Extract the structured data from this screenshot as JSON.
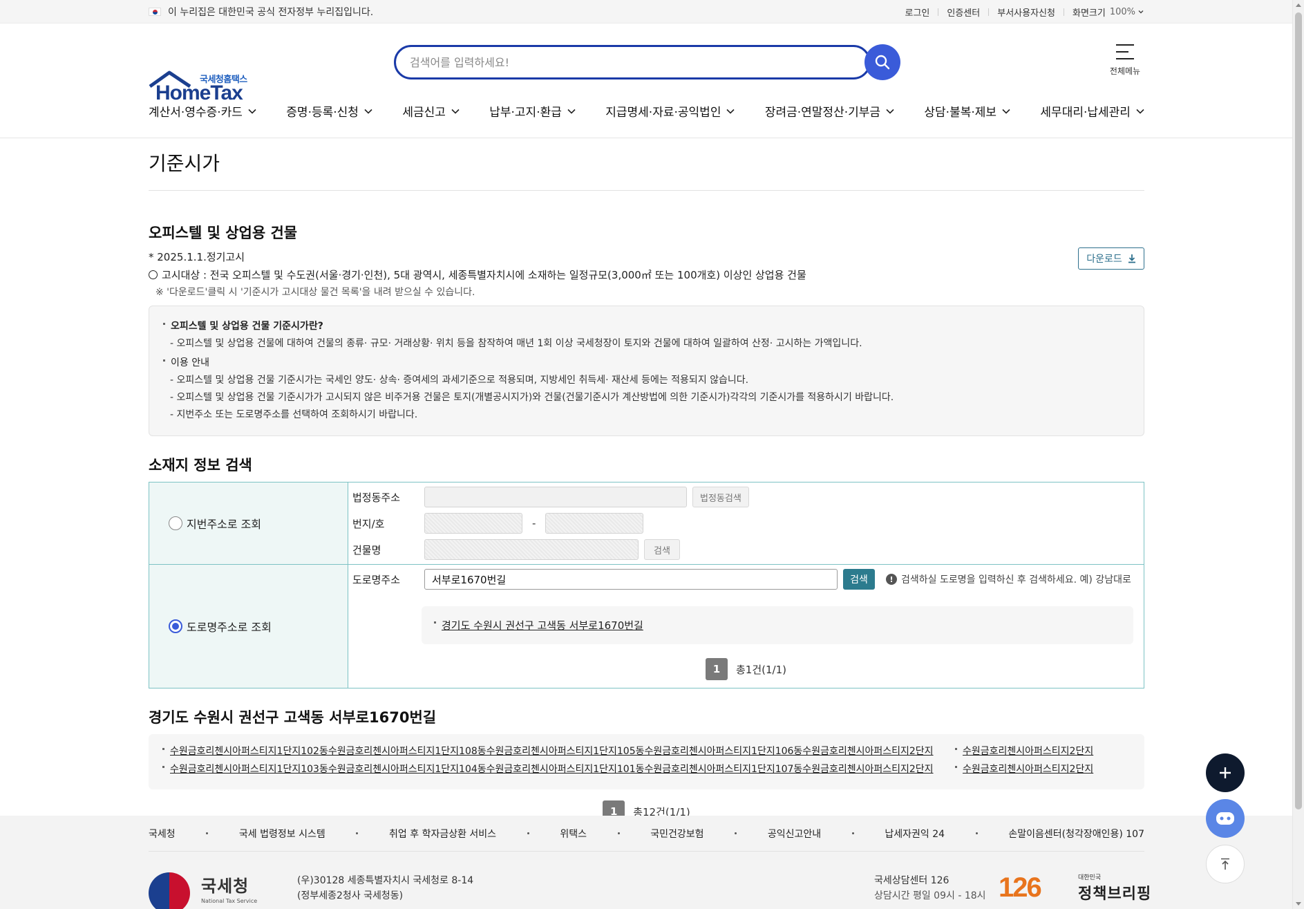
{
  "gov_banner": {
    "text": "이 누리집은 대한민국 공식 전자정부 누리집입니다.",
    "links": [
      "로그인",
      "인증센터",
      "부서사용자신청",
      "화면크기"
    ],
    "zoom": "100%"
  },
  "header": {
    "logo_sub": "국세청홈택스",
    "logo_main": "HomeTax",
    "search_placeholder": "검색어를 입력하세요!",
    "all_menu": "전체메뉴",
    "nav": [
      "계산서·영수증·카드",
      "증명·등록·신청",
      "세금신고",
      "납부·고지·환급",
      "지급명세·자료·공익법인",
      "장려금·연말정산·기부금",
      "상담·불복·제보",
      "세무대리·납세관리"
    ]
  },
  "page": {
    "title": "기준시가",
    "section_title": "오피스텔 및 상업용 건물",
    "notice_date": "* 2025.1.1.정기고시",
    "notice_target": "고시대상 : 전국 오피스텔 및 수도권(서울·경기·인천), 5대 광역시, 세종특별자치시에 소재하는 일정규모(3,000㎡ 또는 100개호) 이상인 상업용 건물",
    "notice_download": "※ '다운로드'클릭 시 '기준시가 고시대상 물건 목록'을 내려 받으실 수 있습니다.",
    "download_label": "다운로드",
    "info": {
      "q_title": "오피스텔 및 상업용 건물 기준시가란?",
      "q_desc": "- 오피스텔 및 상업용 건물에 대하여 건물의 종류· 규모· 거래상황· 위치 등을 참작하여 매년 1회 이상 국세청장이 토지와 건물에 대하여 일괄하여 산정· 고시하는 가액입니다.",
      "use_title": "이용 안내",
      "use_items": [
        "- 오피스텔 및 상업용 건물 기준시가는 국세인 양도· 상속· 증여세의 과세기준으로 적용되며, 지방세인 취득세· 재산세 등에는 적용되지 않습니다.",
        "- 오피스텔 및 상업용 건물 기준시가가 고시되지 않은 비주거용 건물은 토지(개별공시지가)와 건물(건물기준시가 계산방법에 의한 기준시가)각각의 기준시가를 적용하시기 바랍니다.",
        "- 지번주소 또는 도로명주소를 선택하여 조회하시기 바랍니다."
      ]
    }
  },
  "search": {
    "title": "소재지 정보 검색",
    "jibun_radio": "지번주소로 조회",
    "road_radio": "도로명주소로 조회",
    "jibun_fields": {
      "dong_label": "법정동주소",
      "dong_btn": "법정동검색",
      "bunji_label": "번지/호",
      "bunji_dash": "-",
      "bld_label": "건물명",
      "bld_btn": "검색"
    },
    "road": {
      "label": "도로명주소",
      "value": "서부로1670번길",
      "btn": "검색",
      "hint": "검색하실 도로명을 입력하신 후 검색하세요. 예) 강남대로",
      "result": "경기도 수원시 권선구 고색동 서부로1670번길",
      "page": "1",
      "total": "총1건(1/1)"
    }
  },
  "buildings": {
    "title": "경기도 수원시 권선구 고색동 서부로1670번길",
    "row1": "수원금호리첸시아퍼스티지1단지102동수원금호리첸시아퍼스티지1단지108동수원금호리첸시아퍼스티지1단지105동수원금호리첸시아퍼스티지1단지106동수원금호리첸시아퍼스티지2단지",
    "row1b": "수원금호리첸시아퍼스티지2단지",
    "row2": "수원금호리첸시아퍼스티지1단지103동수원금호리첸시아퍼스티지1단지104동수원금호리첸시아퍼스티지1단지101동수원금호리첸시아퍼스티지1단지107동수원금호리첸시아퍼스티지2단지",
    "row2b": "수원금호리첸시아퍼스티지2단지",
    "page": "1",
    "total": "총12건(1/1)"
  },
  "footer": {
    "links": [
      "국세청",
      "국세 법령정보 시스템",
      "취업 후 학자금상환 서비스",
      "위택스",
      "국민건강보험",
      "공익신고안내",
      "납세자권익 24",
      "손말이음센터(청각장애인용) 107"
    ],
    "org_kr": "국세청",
    "org_en": "National Tax Service",
    "addr1": "(우)30128 세종특별자치시 국세청로 8-14",
    "addr2": "(정부세종2청사 국세청동)",
    "center": "국세상담센터 126",
    "hours": "상담시간 평일 09시 - 18시",
    "badge_126": "126",
    "brief_small": "대한민국",
    "brief_big": "정책브리핑"
  }
}
